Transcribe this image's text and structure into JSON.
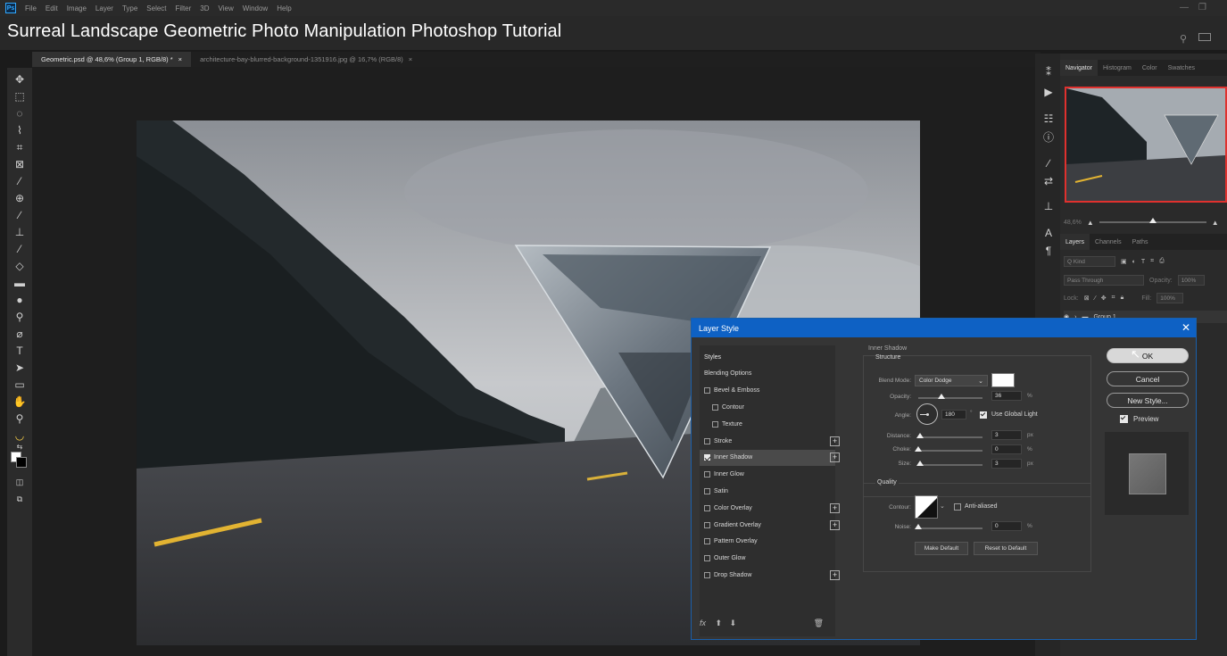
{
  "video_title": "Surreal Landscape Geometric Photo Manipulation Photoshop Tutorial",
  "menu": [
    "File",
    "Edit",
    "Image",
    "Layer",
    "Type",
    "Select",
    "Filter",
    "3D",
    "View",
    "Window",
    "Help"
  ],
  "ps_logo": "Ps",
  "tabs": [
    {
      "label": "Geometric.psd @ 48,6% (Group 1, RGB/8) *",
      "close": "×"
    },
    {
      "label": "architecture-bay-blurred-background-1351916.jpg @ 16,7% (RGB/8)",
      "close": "×"
    }
  ],
  "navigator": {
    "tabs": [
      "Navigator",
      "Histogram",
      "Color",
      "Swatches"
    ],
    "zoom": "48,6%"
  },
  "layers_panel": {
    "tabs": [
      "Layers",
      "Channels",
      "Paths"
    ],
    "kind_label": "Q Kind",
    "blend_mode": "Pass Through",
    "opacity_label": "Opacity:",
    "opacity_value": "100%",
    "lock_label": "Lock:",
    "fill_label": "Fill:",
    "fill_value": "100%",
    "layer_name": "Group 1"
  },
  "dialog": {
    "title": "Layer Style",
    "close": "✕",
    "styles": [
      {
        "label": "Styles",
        "checkbox": false,
        "indent": false,
        "plus": false,
        "checked": false
      },
      {
        "label": "Blending Options",
        "checkbox": false,
        "indent": false,
        "plus": false,
        "checked": false
      },
      {
        "label": "Bevel & Emboss",
        "checkbox": true,
        "indent": false,
        "plus": false,
        "checked": false
      },
      {
        "label": "Contour",
        "checkbox": true,
        "indent": true,
        "plus": false,
        "checked": false
      },
      {
        "label": "Texture",
        "checkbox": true,
        "indent": true,
        "plus": false,
        "checked": false
      },
      {
        "label": "Stroke",
        "checkbox": true,
        "indent": false,
        "plus": true,
        "checked": false
      },
      {
        "label": "Inner Shadow",
        "checkbox": true,
        "indent": false,
        "plus": true,
        "checked": true,
        "selected": true
      },
      {
        "label": "Inner Glow",
        "checkbox": true,
        "indent": false,
        "plus": false,
        "checked": false
      },
      {
        "label": "Satin",
        "checkbox": true,
        "indent": false,
        "plus": false,
        "checked": false
      },
      {
        "label": "Color Overlay",
        "checkbox": true,
        "indent": false,
        "plus": true,
        "checked": false
      },
      {
        "label": "Gradient Overlay",
        "checkbox": true,
        "indent": false,
        "plus": true,
        "checked": false
      },
      {
        "label": "Pattern Overlay",
        "checkbox": true,
        "indent": false,
        "plus": false,
        "checked": false
      },
      {
        "label": "Outer Glow",
        "checkbox": true,
        "indent": false,
        "plus": false,
        "checked": false
      },
      {
        "label": "Drop Shadow",
        "checkbox": true,
        "indent": false,
        "plus": true,
        "checked": false
      }
    ],
    "footer_fx": "fx",
    "section_title": "Inner Shadow",
    "structure_title": "Structure",
    "blend_mode_label": "Blend Mode:",
    "blend_mode_value": "Color Dodge",
    "blend_color": "#ffffff",
    "opacity_label": "Opacity:",
    "opacity_value": "36",
    "opacity_level": 0.36,
    "percent": "%",
    "angle_label": "Angle:",
    "angle_value": "180",
    "degree": "°",
    "use_global_light": "Use Global Light",
    "distance_label": "Distance:",
    "distance_value": "3",
    "choke_label": "Choke:",
    "choke_value": "0",
    "size_label": "Size:",
    "size_value": "3",
    "px": "px",
    "quality_title": "Quality",
    "contour_label": "Contour:",
    "anti_aliased": "Anti-aliased",
    "noise_label": "Noise:",
    "noise_value": "0",
    "make_default": "Make Default",
    "reset_default": "Reset to Default",
    "ok": "OK",
    "cancel": "Cancel",
    "new_style": "New Style...",
    "preview": "Preview"
  }
}
